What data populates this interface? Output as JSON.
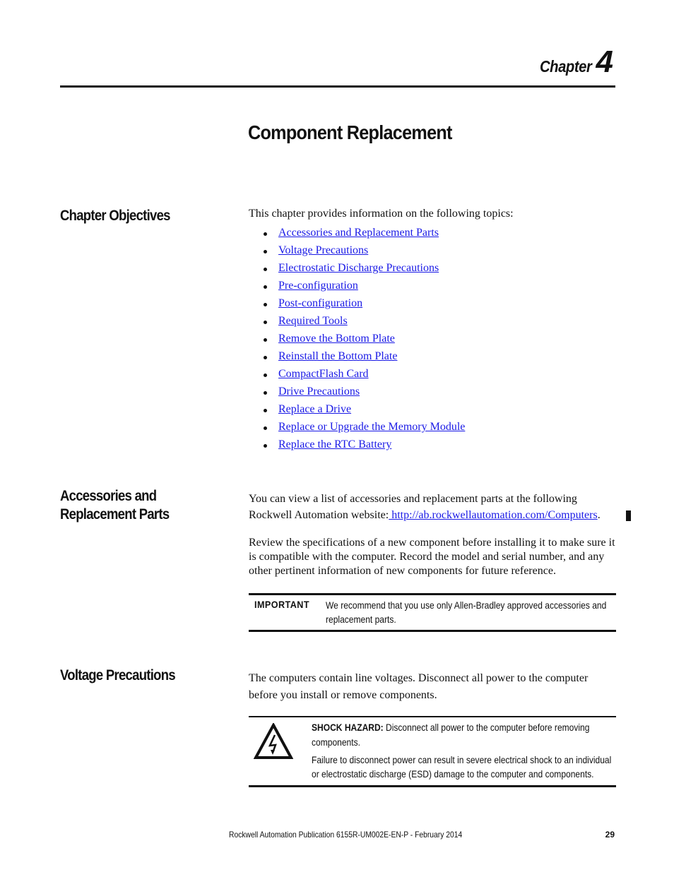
{
  "chapter": {
    "word": "Chapter",
    "number": "4"
  },
  "title": "Component Replacement",
  "sections": {
    "objectives": {
      "heading": "Chapter Objectives",
      "intro": "This chapter provides information on the following topics:",
      "topics": [
        "Accessories and Replacement Parts",
        "Voltage Precautions",
        "Electrostatic Discharge Precautions",
        "Pre-configuration",
        "Post-configuration",
        "Required Tools",
        "Remove the Bottom Plate",
        "Reinstall the Bottom Plate",
        "CompactFlash Card",
        "Drive Precautions",
        "Replace a Drive",
        "Replace or Upgrade the Memory Module",
        "Replace the RTC Battery"
      ]
    },
    "accessories": {
      "heading": "Accessories and Replacement Parts",
      "para1_prefix": "You can view a list of accessories and replacement parts at the following Rockwell Automation website:",
      "link": " http://ab.rockwellautomation.com/Computers",
      "para1_suffix": ".",
      "para2": "Review the specifications of a new component before installing it to make sure it is compatible with the computer. Record the model and serial number, and any other pertinent information of new components for future reference.",
      "important_label": "IMPORTANT",
      "important_text": "We recommend that you use only Allen-Bradley approved accessories and replacement parts."
    },
    "voltage": {
      "heading": "Voltage Precautions",
      "para": "The computers contain line voltages. Disconnect all power to the computer before you install or remove components.",
      "hazard_label": "SHOCK HAZARD:",
      "hazard_text": " Disconnect all power to the computer before removing components.",
      "hazard_text2": "Failure to disconnect power can result in severe electrical shock to an individual or electrostatic discharge (ESD) damage to the computer and components.",
      "icon": "shock-hazard-icon"
    }
  },
  "footer": {
    "publication": "Rockwell Automation Publication 6155R-UM002E-EN-P - February 2014",
    "page": "29"
  },
  "colors": {
    "link": "#1a1ae6",
    "text": "#111111"
  }
}
